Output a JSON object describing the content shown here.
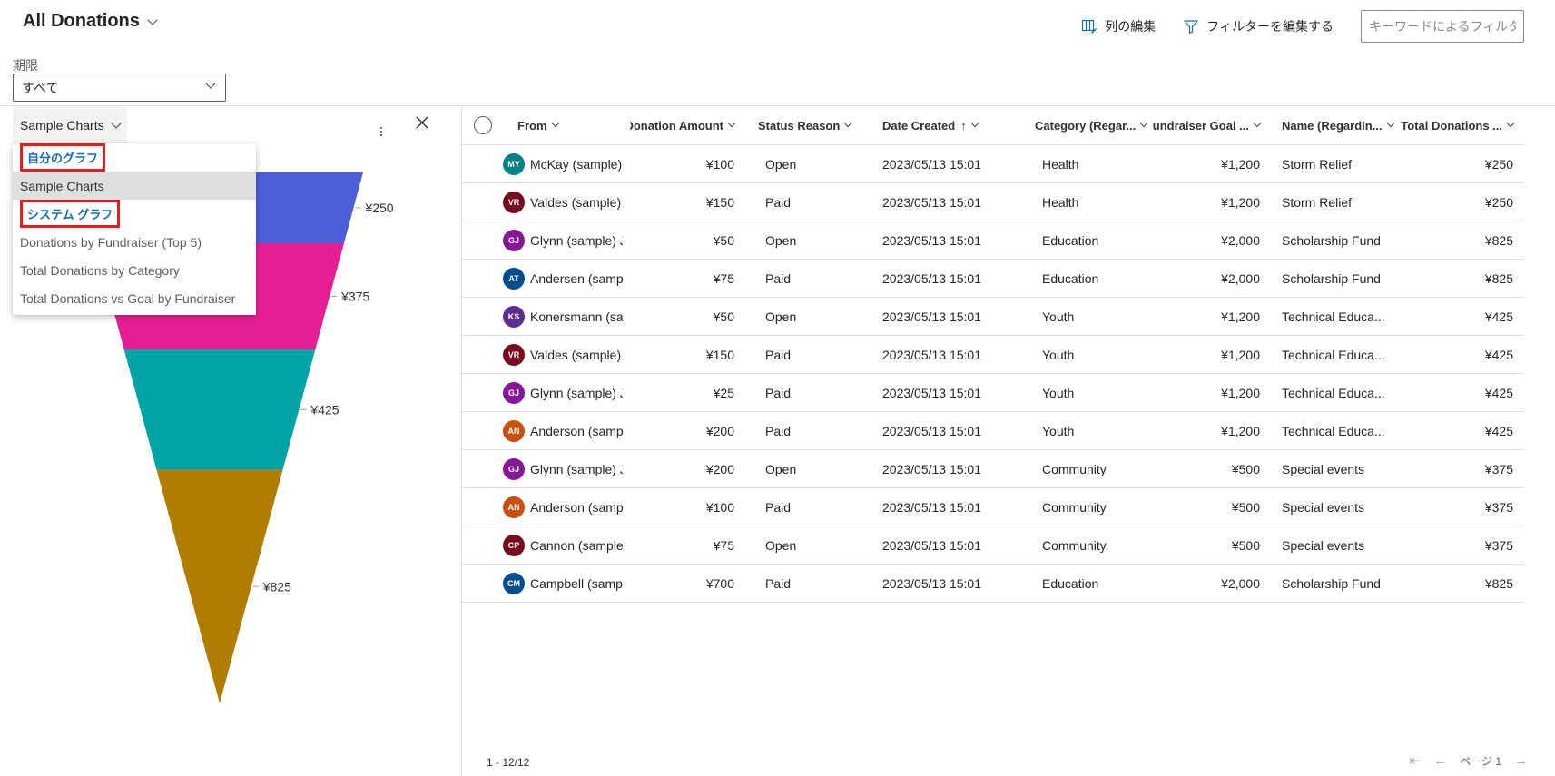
{
  "header": {
    "view_title": "All Donations",
    "edit_columns_label": "列の編集",
    "edit_filters_label": "フィルターを編集する",
    "keyword_filter_placeholder": "キーワードによるフィルタ"
  },
  "period": {
    "label": "期限",
    "value": "すべて"
  },
  "chart_pane": {
    "selector_label": "Sample Charts",
    "menu": {
      "my_charts_header": "自分のグラフ",
      "my_charts": [
        "Sample Charts"
      ],
      "system_charts_header": "システム グラフ",
      "system_charts": [
        "Donations by Fundraiser (Top 5)",
        "Total Donations by Category",
        "Total Donations vs Goal by Fundraiser"
      ],
      "selected": "Sample Charts"
    }
  },
  "chart_data": {
    "type": "funnel",
    "title": "",
    "segments": [
      {
        "label": "¥250",
        "value": 250,
        "color": "#4a5fd8"
      },
      {
        "label": "¥375",
        "value": 375,
        "color": "#e61e96"
      },
      {
        "label": "¥425",
        "value": 425,
        "color": "#00a4a6"
      },
      {
        "label": "¥825",
        "value": 825,
        "color": "#b07d00"
      }
    ]
  },
  "grid": {
    "columns": [
      "From",
      "Donation Amount",
      "Status Reason",
      "Date Created",
      "Category (Regar...",
      "Fundraiser Goal ...",
      "Name (Regardin...",
      "Total Donations ..."
    ],
    "sorted_column": "Date Created",
    "sort_direction": "ascending",
    "rows": [
      {
        "initials": "MY",
        "avatar_color": "#038387",
        "from": "McKay (sample) Y",
        "amount": "¥100",
        "status": "Open",
        "date": "2023/05/13 15:01",
        "category": "Health",
        "goal": "¥1,200",
        "name": "Storm Relief",
        "total": "¥250"
      },
      {
        "initials": "VR",
        "avatar_color": "#750b1c",
        "from": "Valdes (sample) F",
        "amount": "¥150",
        "status": "Paid",
        "date": "2023/05/13 15:01",
        "category": "Health",
        "goal": "¥1,200",
        "name": "Storm Relief",
        "total": "¥250"
      },
      {
        "initials": "GJ",
        "avatar_color": "#881798",
        "from": "Glynn (sample) Ji",
        "amount": "¥50",
        "status": "Open",
        "date": "2023/05/13 15:01",
        "category": "Education",
        "goal": "¥2,000",
        "name": "Scholarship Fund",
        "total": "¥825"
      },
      {
        "initials": "AT",
        "avatar_color": "#004e8c",
        "from": "Andersen (sampl",
        "amount": "¥75",
        "status": "Paid",
        "date": "2023/05/13 15:01",
        "category": "Education",
        "goal": "¥2,000",
        "name": "Scholarship Fund",
        "total": "¥825"
      },
      {
        "initials": "KS",
        "avatar_color": "#5c2e91",
        "from": "Konersmann (sar",
        "amount": "¥50",
        "status": "Open",
        "date": "2023/05/13 15:01",
        "category": "Youth",
        "goal": "¥1,200",
        "name": "Technical Educa...",
        "total": "¥425"
      },
      {
        "initials": "VR",
        "avatar_color": "#750b1c",
        "from": "Valdes (sample) F",
        "amount": "¥150",
        "status": "Paid",
        "date": "2023/05/13 15:01",
        "category": "Youth",
        "goal": "¥1,200",
        "name": "Technical Educa...",
        "total": "¥425"
      },
      {
        "initials": "GJ",
        "avatar_color": "#881798",
        "from": "Glynn (sample) Ji",
        "amount": "¥25",
        "status": "Paid",
        "date": "2023/05/13 15:01",
        "category": "Youth",
        "goal": "¥1,200",
        "name": "Technical Educa...",
        "total": "¥425"
      },
      {
        "initials": "AN",
        "avatar_color": "#ca5010",
        "from": "Anderson (sampl",
        "amount": "¥200",
        "status": "Paid",
        "date": "2023/05/13 15:01",
        "category": "Youth",
        "goal": "¥1,200",
        "name": "Technical Educa...",
        "total": "¥425"
      },
      {
        "initials": "GJ",
        "avatar_color": "#881798",
        "from": "Glynn (sample) Ji",
        "amount": "¥200",
        "status": "Open",
        "date": "2023/05/13 15:01",
        "category": "Community",
        "goal": "¥500",
        "name": "Special events",
        "total": "¥375"
      },
      {
        "initials": "AN",
        "avatar_color": "#ca5010",
        "from": "Anderson (sampl",
        "amount": "¥100",
        "status": "Paid",
        "date": "2023/05/13 15:01",
        "category": "Community",
        "goal": "¥500",
        "name": "Special events",
        "total": "¥375"
      },
      {
        "initials": "CP",
        "avatar_color": "#750b1c",
        "from": "Cannon (sample)",
        "amount": "¥75",
        "status": "Open",
        "date": "2023/05/13 15:01",
        "category": "Community",
        "goal": "¥500",
        "name": "Special events",
        "total": "¥375"
      },
      {
        "initials": "CM",
        "avatar_color": "#004e8c",
        "from": "Campbell (sampl",
        "amount": "¥700",
        "status": "Paid",
        "date": "2023/05/13 15:01",
        "category": "Education",
        "goal": "¥2,000",
        "name": "Scholarship Fund",
        "total": "¥825"
      }
    ]
  },
  "footer": {
    "record_count": "1 - 12/12",
    "page_label": "ページ 1"
  }
}
